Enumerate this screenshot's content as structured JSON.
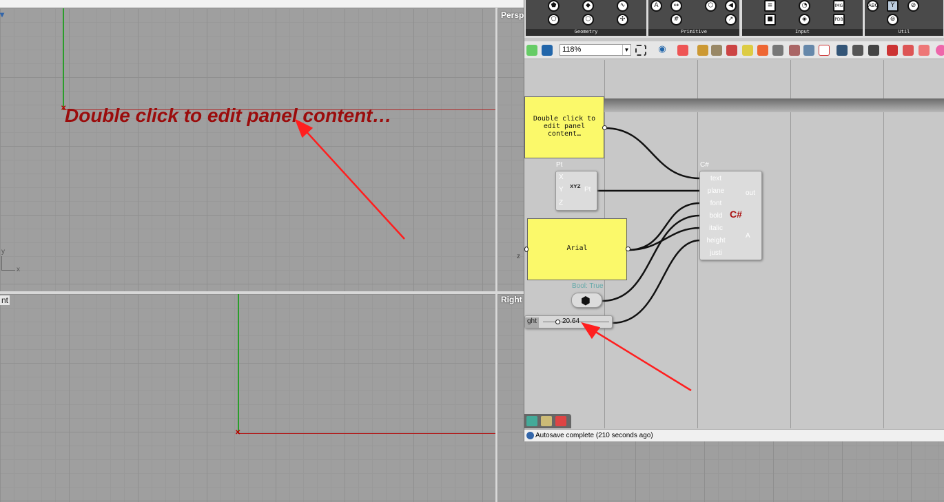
{
  "viewports": {
    "top_label": "▾",
    "perspective_label": "Perspe",
    "front_label": "nt",
    "right_label": "Right",
    "top_axis_y": "y",
    "top_axis_x": "x",
    "persp_axis_z": "z"
  },
  "preview_text": "Double click to edit panel content…",
  "ribbon": {
    "groups": [
      "Geometry",
      "Primitive",
      "Input",
      "Util"
    ]
  },
  "toolbar": {
    "zoom": "118%"
  },
  "panel1": {
    "text": "Double click to edit panel content…"
  },
  "pt": {
    "label": "Pt",
    "inputs": [
      "X",
      "Y",
      "Z"
    ],
    "output": "Pt",
    "icon": "XYZ"
  },
  "panel2": {
    "text": "Arial"
  },
  "bool": {
    "label": "Bool: True"
  },
  "slider": {
    "name": "ght",
    "value": "20.64"
  },
  "csharp": {
    "label": "C#",
    "inputs": [
      "text",
      "plane",
      "font",
      "bold",
      "italic",
      "height",
      "justi"
    ],
    "outputs": [
      "out",
      "A"
    ],
    "logo": "C#"
  },
  "status": {
    "text": "Autosave complete (210 seconds ago)"
  },
  "colors": {
    "panel": "#fbf96a",
    "preview_text": "#9b0c0c",
    "arrow": "#ff1e1e",
    "grid": "#9f9f9f"
  }
}
